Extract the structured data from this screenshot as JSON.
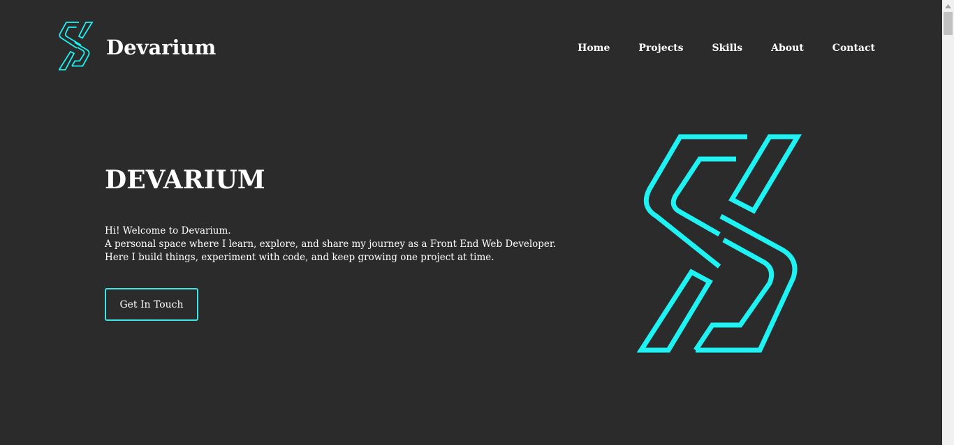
{
  "colors": {
    "background": "#2b2b2b",
    "accent": "#1ef2f2",
    "text": "#ffffff",
    "scrollbar_track": "#f1f1f1",
    "scrollbar_thumb": "#c1c1c1"
  },
  "header": {
    "brand_name": "Devarium",
    "logo_icon": "devarium-s-logo-icon",
    "nav": [
      {
        "label": "Home"
      },
      {
        "label": "Projects"
      },
      {
        "label": "Skills"
      },
      {
        "label": "About"
      },
      {
        "label": "Contact"
      }
    ]
  },
  "hero": {
    "title": "DEVARIUM",
    "lines": [
      "Hi! Welcome to Devarium.",
      "A personal space where I learn, explore, and share my journey as a Front End Web Developer.",
      "Here I build things, experiment with code, and keep growing one project at time."
    ],
    "cta_label": "Get In Touch",
    "logo_icon": "devarium-s-logo-icon"
  },
  "scrollbar": {
    "up_icon": "scroll-up-arrow-icon"
  }
}
